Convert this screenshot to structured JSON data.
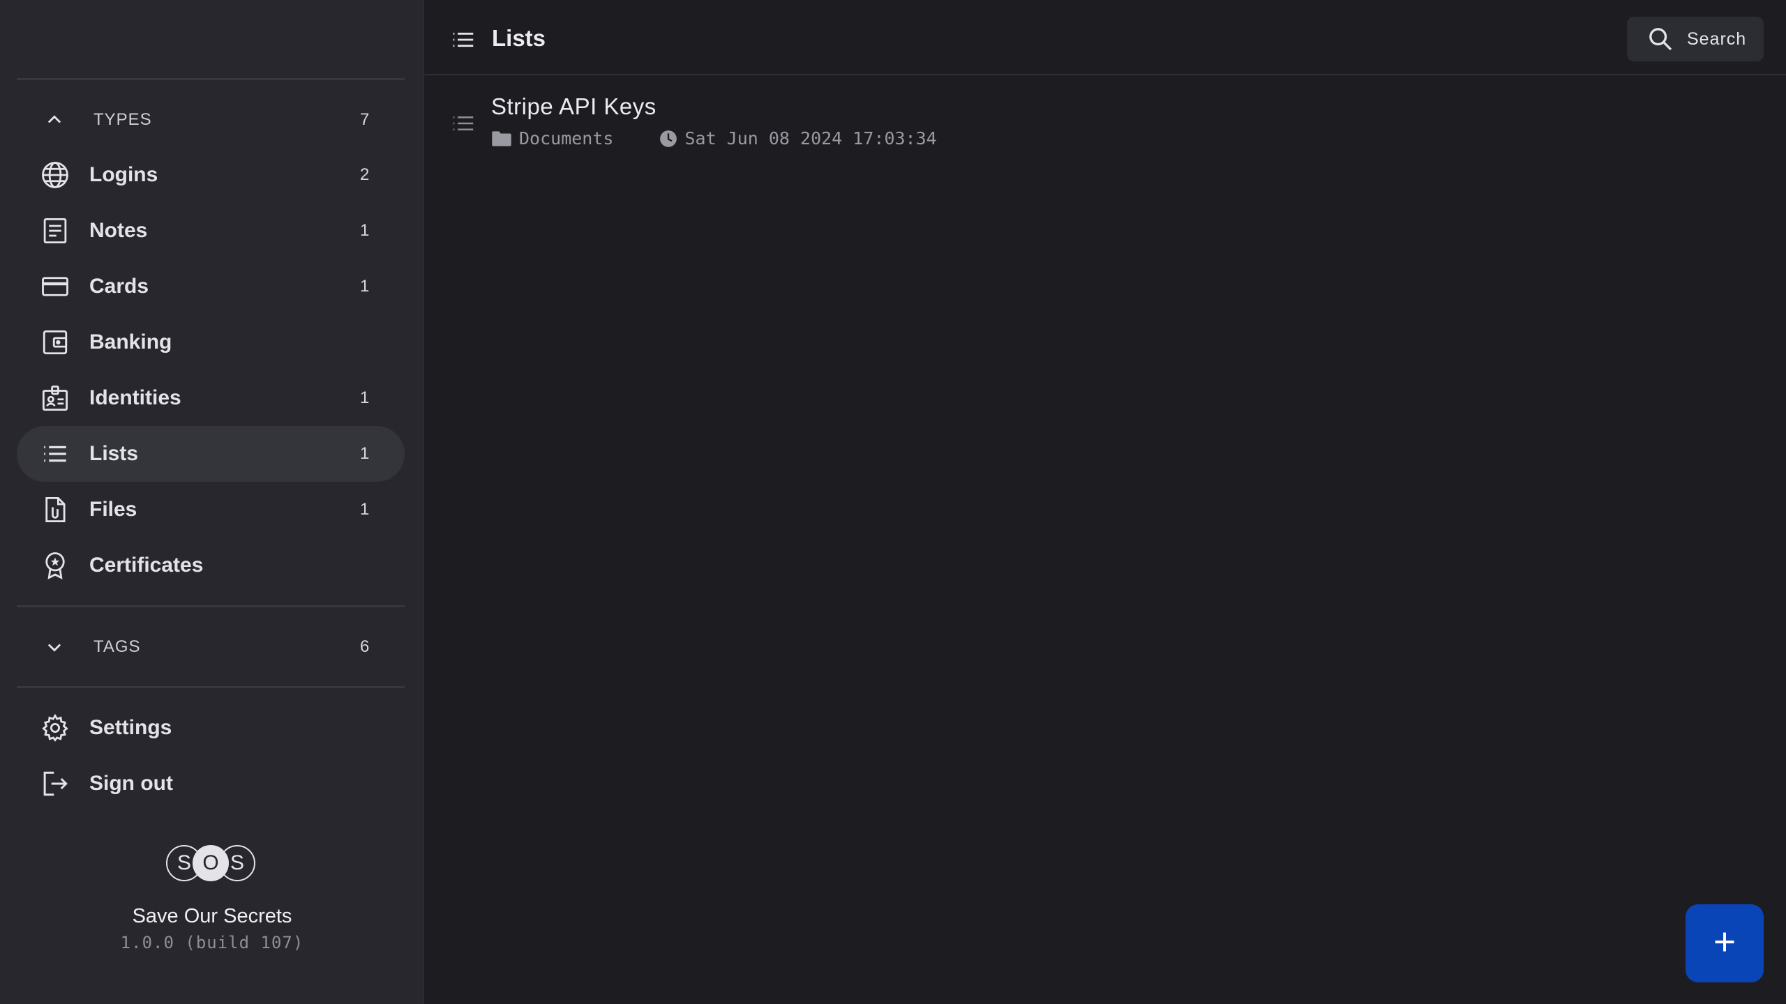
{
  "sidebar": {
    "types_section": {
      "label": "TYPES",
      "count": "7"
    },
    "items": [
      {
        "label": "Logins",
        "count": "2",
        "icon": "globe-icon"
      },
      {
        "label": "Notes",
        "count": "1",
        "icon": "note-icon"
      },
      {
        "label": "Cards",
        "count": "1",
        "icon": "credit-card-icon"
      },
      {
        "label": "Banking",
        "count": "",
        "icon": "wallet-icon"
      },
      {
        "label": "Identities",
        "count": "1",
        "icon": "id-badge-icon"
      },
      {
        "label": "Lists",
        "count": "1",
        "icon": "list-icon",
        "active": true
      },
      {
        "label": "Files",
        "count": "1",
        "icon": "file-attachment-icon"
      },
      {
        "label": "Certificates",
        "count": "",
        "icon": "certificate-icon"
      }
    ],
    "tags_section": {
      "label": "TAGS",
      "count": "6"
    },
    "settings_label": "Settings",
    "signout_label": "Sign out",
    "logo_letters": [
      "S",
      "O",
      "S"
    ],
    "app_name": "Save Our Secrets",
    "app_version": "1.0.0 (build 107)"
  },
  "header": {
    "title": "Lists",
    "search_label": "Search"
  },
  "entries": [
    {
      "name": "Stripe API Keys",
      "folder": "Documents",
      "timestamp": "Sat Jun 08 2024 17:03:34"
    }
  ],
  "colors": {
    "background": "#1c1c21",
    "sidebar": "#27272d",
    "active_item": "#34343b",
    "fab": "#0a45b8"
  },
  "fab": {
    "icon": "plus-icon"
  }
}
